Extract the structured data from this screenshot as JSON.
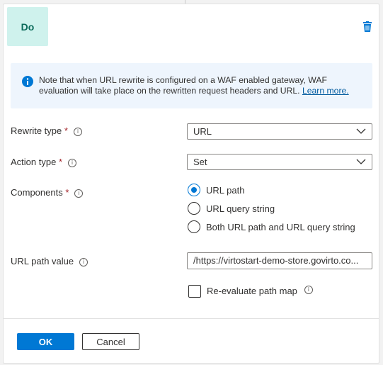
{
  "condition_badge": "Do",
  "info": {
    "text": "Note that when URL rewrite is configured on a WAF enabled gateway, WAF evaluation will take place on the rewritten request headers and URL.",
    "link": "Learn more."
  },
  "fields": {
    "rewrite_type": {
      "label": "Rewrite type",
      "value": "URL"
    },
    "action_type": {
      "label": "Action type",
      "value": "Set"
    },
    "components": {
      "label": "Components",
      "options": [
        "URL path",
        "URL query string",
        "Both URL path and URL query string"
      ],
      "selected": "URL path"
    },
    "url_path_value": {
      "label": "URL path value",
      "value": "/https://virtostart-demo-store.govirto.co..."
    },
    "reevaluate": {
      "label": "Re-evaluate path map",
      "checked": false
    }
  },
  "required_mark": "*",
  "buttons": {
    "ok": "OK",
    "cancel": "Cancel"
  },
  "colors": {
    "accent": "#0078d4",
    "badge_bg": "#cff2ed",
    "info_bg": "#eef5fd"
  }
}
